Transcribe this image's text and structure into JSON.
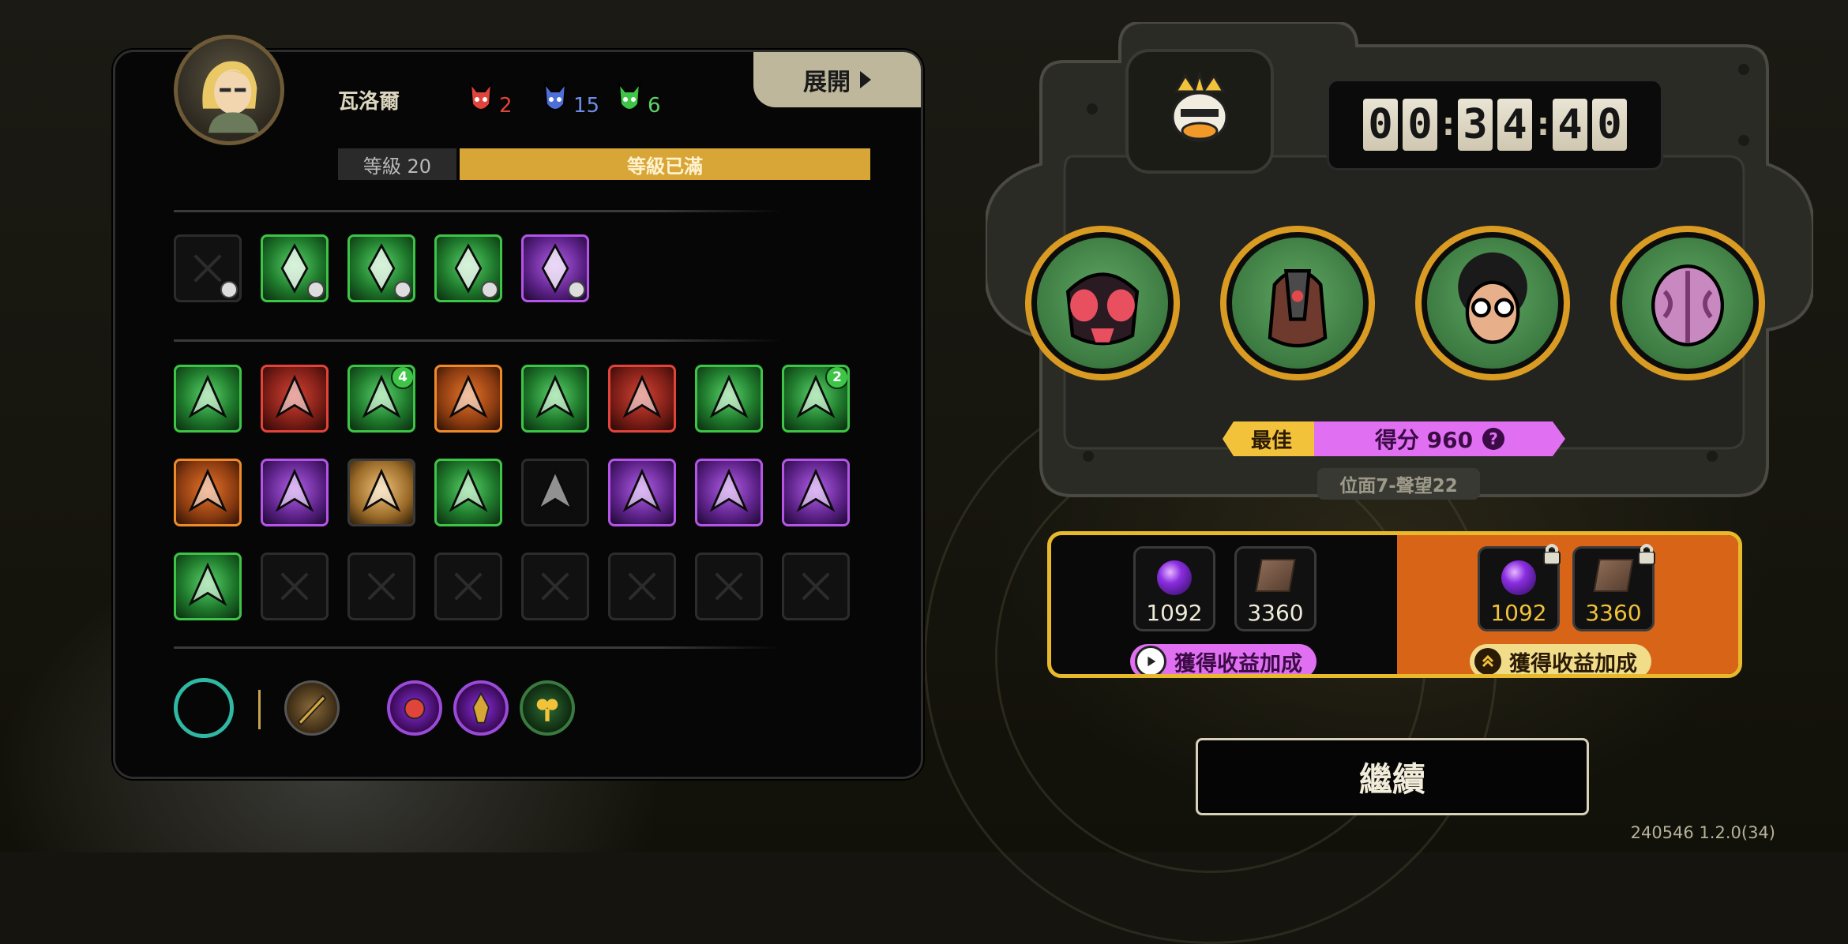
{
  "hero": {
    "name": "瓦洛爾",
    "level_label": "等級 20",
    "level_status": "等級已滿",
    "level_progress": 1.0,
    "expand_label": "展開",
    "stats": [
      {
        "icon": "red-demon-icon",
        "value": "2",
        "color": "#e0443a"
      },
      {
        "icon": "blue-demon-icon",
        "value": "15",
        "color": "#4e6fd8"
      },
      {
        "icon": "green-demon-icon",
        "value": "6",
        "color": "#3ec447"
      }
    ]
  },
  "skills_row": [
    {
      "icon": "empty-skill-slot",
      "style": "grey"
    },
    {
      "icon": "green-burst-skill-icon",
      "style": "green"
    },
    {
      "icon": "green-spikes-skill-icon",
      "style": "green"
    },
    {
      "icon": "green-crystal-skill-icon",
      "style": "green"
    },
    {
      "icon": "purple-mask-skill-icon",
      "style": "purple"
    }
  ],
  "relics": [
    {
      "icon": "green-horns-relic-icon",
      "style": "green"
    },
    {
      "icon": "red-fang-relic-icon",
      "style": "red"
    },
    {
      "icon": "green-shards-relic-icon",
      "style": "green",
      "badge": "4"
    },
    {
      "icon": "orange-flame-relic-icon",
      "style": "orange"
    },
    {
      "icon": "green-slash-relic-icon",
      "style": "green"
    },
    {
      "icon": "purple-beast-relic-icon",
      "style": "red"
    },
    {
      "icon": "purple-arrow-relic-icon",
      "style": "green"
    },
    {
      "icon": "purple-hand-relic-icon",
      "style": "green",
      "badge": "2"
    },
    {
      "icon": "gold-helmet-relic-icon",
      "style": "orange"
    },
    {
      "icon": "gold-ring-relic-icon",
      "style": "purple"
    },
    {
      "icon": "gold-sun-relic-icon",
      "style": "gold"
    },
    {
      "icon": "purple-web-relic-icon",
      "style": "green"
    },
    {
      "icon": "green-claws-relic-icon",
      "style": "grey"
    },
    {
      "icon": "purple-crown-relic-icon",
      "style": "purple"
    },
    {
      "icon": "purple-storm-relic-icon",
      "style": "purple"
    },
    {
      "icon": "blue-vortex-relic-icon",
      "style": "purple"
    },
    {
      "icon": "pink-rose-relic-icon",
      "style": "green"
    }
  ],
  "timer": {
    "digits": [
      "0",
      "0",
      "3",
      "4",
      "4",
      "0"
    ]
  },
  "best_label": "最佳",
  "score_label": "得分 960",
  "stage_label": "位面7-聲望22",
  "enemies": [
    {
      "icon": "red-bug-portrait-icon"
    },
    {
      "icon": "beak-creature-portrait-icon"
    },
    {
      "icon": "afro-glasses-portrait-icon"
    },
    {
      "icon": "pink-brain-portrait-icon"
    }
  ],
  "rewards": {
    "base": [
      {
        "icon": "purple-orb-icon",
        "value": "1092"
      },
      {
        "icon": "book-icon",
        "value": "3360"
      }
    ],
    "boosted": [
      {
        "icon": "purple-orb-icon",
        "value": "1092"
      },
      {
        "icon": "book-icon",
        "value": "3360"
      }
    ],
    "ad_bonus_label": "獲得收益加成",
    "rank_bonus_label": "獲得收益加成"
  },
  "continue_label": "繼續",
  "version": "240546 1.2.0(34)"
}
